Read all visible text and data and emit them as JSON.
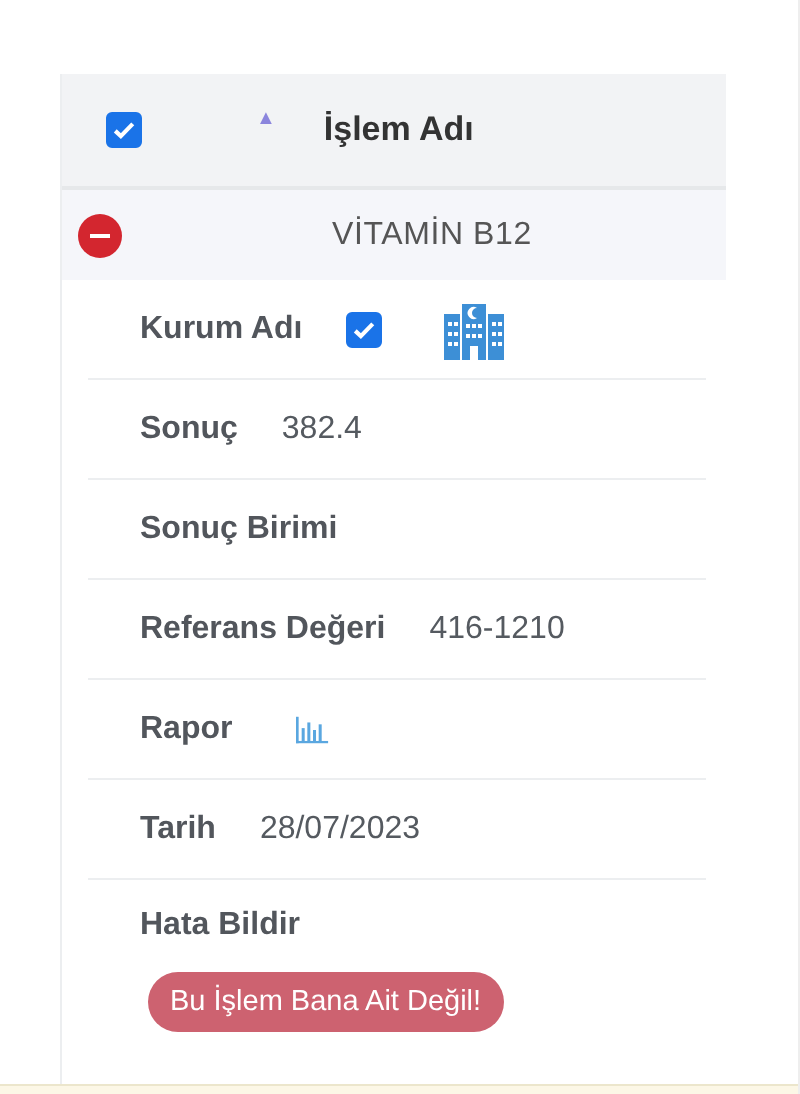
{
  "header": {
    "select_all": {
      "checked": true
    },
    "sort": "▲",
    "column": "İşlem Adı"
  },
  "group": {
    "expanded": true,
    "title": "VİTAMİN B12"
  },
  "details": [
    {
      "kind": "institution",
      "label": "Kurum Adı",
      "checked": true
    },
    {
      "kind": "text",
      "label": "Sonuç",
      "value": "382.4"
    },
    {
      "kind": "text",
      "label": "Sonuç Birimi"
    },
    {
      "kind": "text",
      "label": "Referans Değeri",
      "value": "416-1210"
    },
    {
      "kind": "report",
      "label": "Rapor"
    },
    {
      "kind": "text",
      "label": "Tarih",
      "value": "28/07/2023"
    },
    {
      "kind": "action",
      "label": "Hata Bildir",
      "button": "Bu İşlem Bana Ait Değil!"
    }
  ]
}
